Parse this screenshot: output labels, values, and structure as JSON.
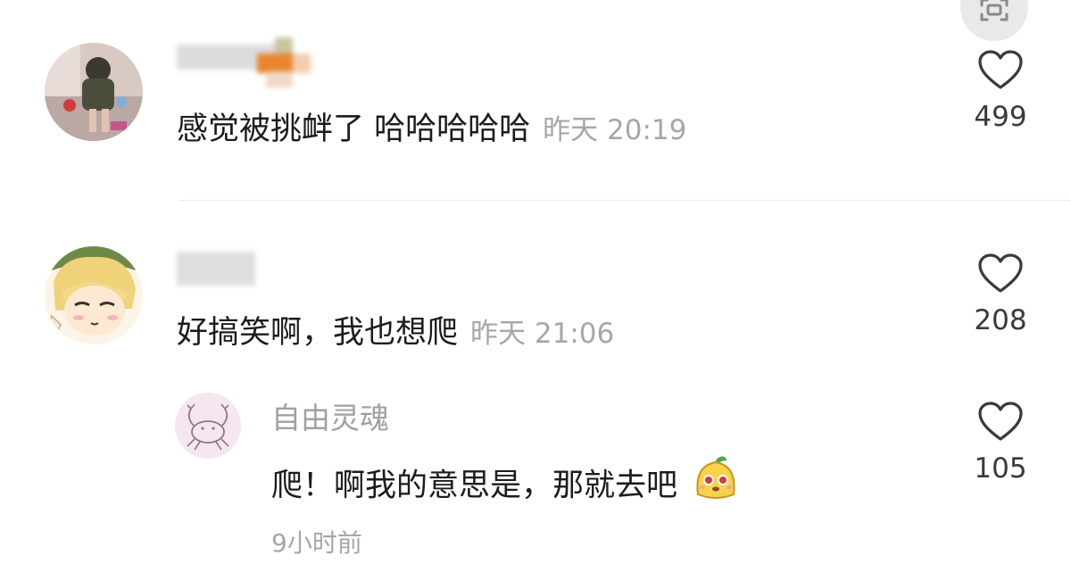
{
  "comments": [
    {
      "name": "",
      "text": "感觉被挑衅了 哈哈哈哈哈",
      "time": "昨天 20:19",
      "likes": "499"
    },
    {
      "name": "",
      "text": "好搞笑啊，我也想爬",
      "time": "昨天 21:06",
      "likes": "208"
    }
  ],
  "reply": {
    "name": "自由灵魂",
    "text": "爬！啊我的意思是，那就去吧",
    "time": "9小时前",
    "likes": "105"
  },
  "icons": {
    "like": "heart-outline-icon",
    "expand": "fullscreen-icon",
    "emoji": "sticker-emoji-icon"
  },
  "colors": {
    "text": "#1c1c1c",
    "muted": "#a7a7a7",
    "count": "#3a3a3a"
  }
}
